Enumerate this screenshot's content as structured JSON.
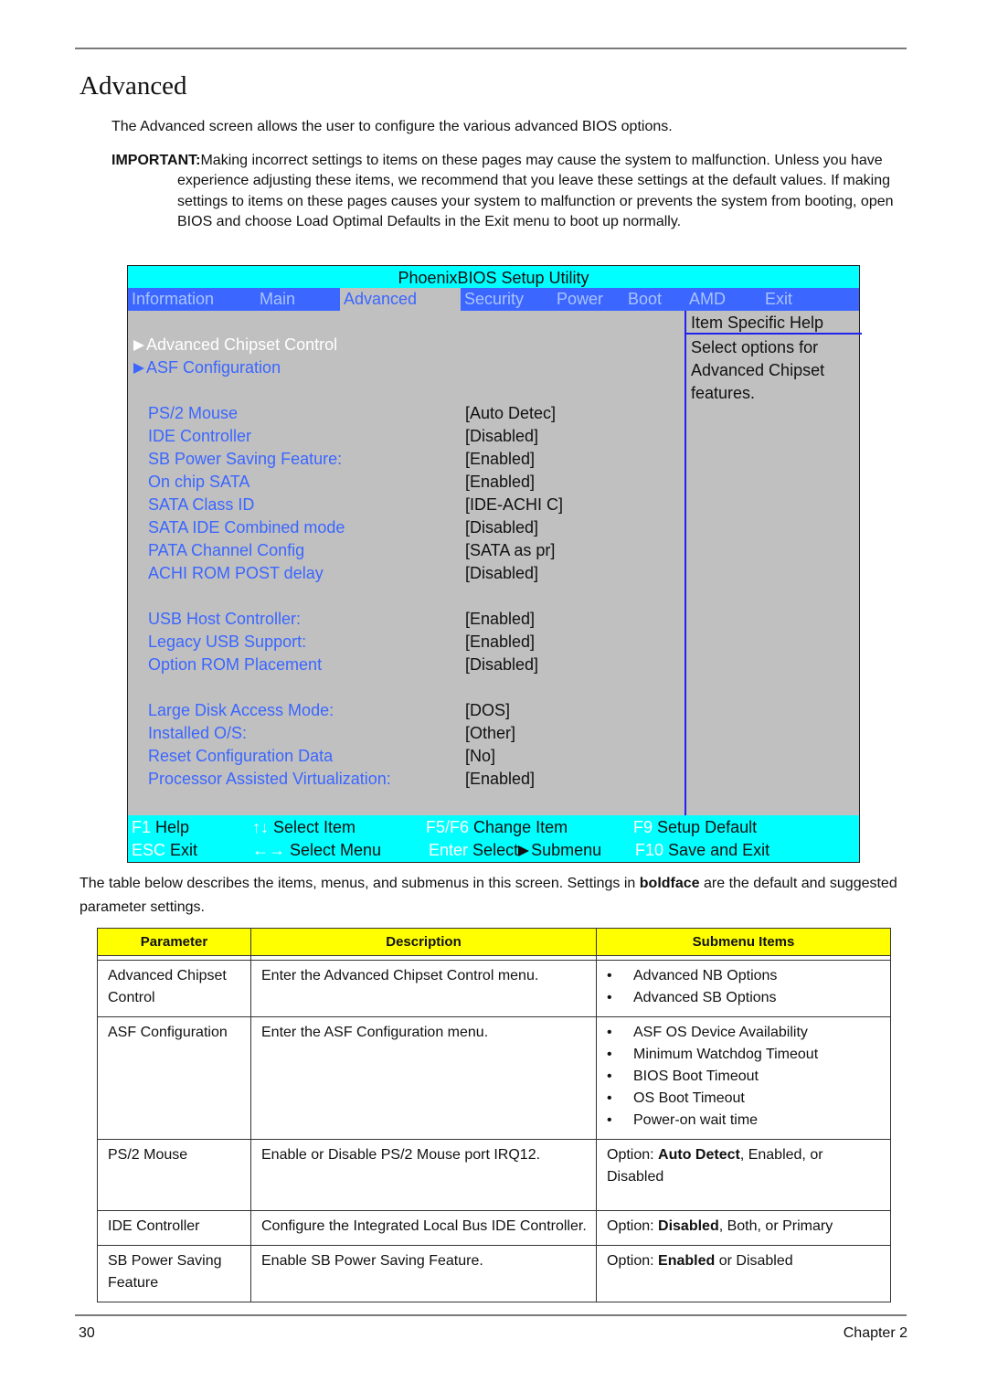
{
  "page": {
    "title": "Advanced",
    "intro": "The Advanced screen allows the user to configure the various advanced BIOS options.",
    "important_label": "IMPORTANT:",
    "important_text": "Making incorrect settings to items on these pages may cause the system to malfunction. Unless you have experience adjusting these items, we recommend that you leave these settings at the default values. If making settings to items on these pages causes your system to malfunction or prevents the system from booting, open BIOS and choose Load Optimal Defaults in the Exit menu to boot up normally.",
    "desc_1": "The table below describes the items, menus, and submenus in this screen. Settings in ",
    "desc_bold": "boldface",
    "desc_2": " are the default and suggested parameter settings.",
    "page_number": "30",
    "chapter": "Chapter 2"
  },
  "bios": {
    "title": "PhoenixBIOS Setup Utility",
    "menu": [
      "Information",
      "Main",
      "Advanced",
      "Security",
      "Power",
      "Boot",
      "AMD",
      "Exit"
    ],
    "active_menu": "Advanced",
    "submenus": [
      {
        "label": "Advanced Chipset Control",
        "selected": true
      },
      {
        "label": "ASF Configuration",
        "selected": false
      }
    ],
    "items": [
      {
        "label": "PS/2 Mouse",
        "value": "[Auto Detec]"
      },
      {
        "label": "IDE Controller",
        "value": "[Disabled]"
      },
      {
        "label": "SB Power Saving Feature:",
        "value": "[Enabled]"
      },
      {
        "label": "On chip SATA",
        "value": "[Enabled]"
      },
      {
        "label": "SATA Class ID",
        "value": "[IDE-ACHI C]"
      },
      {
        "label": "SATA IDE Combined mode",
        "value": "[Disabled]"
      },
      {
        "label": "PATA Channel Config",
        "value": "[SATA as pr]"
      },
      {
        "label": "ACHI ROM POST delay",
        "value": "[Disabled]"
      },
      {
        "label": "USB Host Controller:",
        "value": "[Enabled]"
      },
      {
        "label": "Legacy USB Support:",
        "value": "[Enabled]"
      },
      {
        "label": "Option ROM Placement",
        "value": "[Disabled]"
      },
      {
        "label": "Large Disk Access Mode:",
        "value": "[DOS]"
      },
      {
        "label": "Installed O/S:",
        "value": "[Other]"
      },
      {
        "label": "Reset Configuration Data",
        "value": "[No]"
      },
      {
        "label": "Processor Assisted Virtualization:",
        "value": "[Enabled]"
      }
    ],
    "help": {
      "heading": "Item Specific Help",
      "lines": [
        "Select options for",
        "Advanced Chipset",
        "features."
      ]
    },
    "footer": {
      "f1_key": "F1",
      "f1_label": "Help",
      "updown_glyph": "↑↓",
      "updown_label": "Select Item",
      "f5f6_key": "F5/F6",
      "f5f6_label": "Change Item",
      "f9_key": "F9",
      "f9_label": "Setup Default",
      "esc_key": "ESC",
      "esc_label": "Exit",
      "leftright_glyph": "←→",
      "leftright_label": "Select Menu",
      "enter_key": "Enter",
      "enter_label_1": "Select",
      "enter_label_2": "Submenu",
      "f10_key": "F10",
      "f10_label": "Save and Exit"
    }
  },
  "table": {
    "headers": [
      "Parameter",
      "Description",
      "Submenu Items"
    ],
    "rows": [
      {
        "param": "Advanced Chipset Control",
        "desc": "Enter the Advanced Chipset Control menu.",
        "bullets": [
          "Advanced NB Options",
          "Advanced SB Options"
        ]
      },
      {
        "param": "ASF Configuration",
        "desc": "Enter the ASF Configuration menu.",
        "bullets": [
          "ASF OS Device Availability",
          "Minimum Watchdog Timeout",
          "BIOS Boot Timeout",
          "OS Boot Timeout",
          "Power-on wait time"
        ]
      },
      {
        "param": "PS/2 Mouse",
        "desc": "Enable or Disable PS/2 Mouse port IRQ12.",
        "opt_prefix": "Option: ",
        "opt_bold": "Auto Detect",
        "opt_rest": ", Enabled, or Disabled"
      },
      {
        "param": "IDE Controller",
        "desc": "Configure the Integrated Local Bus IDE Controller.",
        "opt_prefix": "Option: ",
        "opt_bold": "Disabled",
        "opt_rest": ", Both, or Primary"
      },
      {
        "param": "SB Power Saving Feature",
        "desc": "Enable SB Power Saving Feature.",
        "opt_prefix": "Option: ",
        "opt_bold": "Enabled",
        "opt_rest": " or Disabled"
      }
    ]
  }
}
